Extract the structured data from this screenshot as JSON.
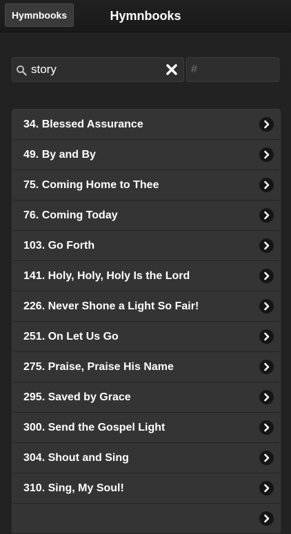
{
  "navbar": {
    "back_label": "Hymnbooks",
    "title": "Hymnbooks"
  },
  "search": {
    "value": "story",
    "number_placeholder": "#"
  },
  "hymns": [
    {
      "label": "34. Blessed Assurance"
    },
    {
      "label": "49. By and By"
    },
    {
      "label": "75. Coming Home to Thee"
    },
    {
      "label": "76. Coming Today"
    },
    {
      "label": "103. Go Forth"
    },
    {
      "label": "141. Holy, Holy, Holy Is the Lord"
    },
    {
      "label": "226. Never Shone a Light So Fair!"
    },
    {
      "label": "251. On Let Us Go"
    },
    {
      "label": "275. Praise, Praise His Name"
    },
    {
      "label": "295. Saved by Grace"
    },
    {
      "label": "300. Send the Gospel Light"
    },
    {
      "label": "304. Shout and Sing"
    },
    {
      "label": "310. Sing, My Soul!"
    },
    {
      "label": ""
    }
  ],
  "colors": {
    "background": "#222222",
    "row": "#343434",
    "text": "#ffffff"
  },
  "icons": {
    "search": "search-icon",
    "clear": "clear-icon",
    "row_arrow": "chevron-right-icon"
  }
}
